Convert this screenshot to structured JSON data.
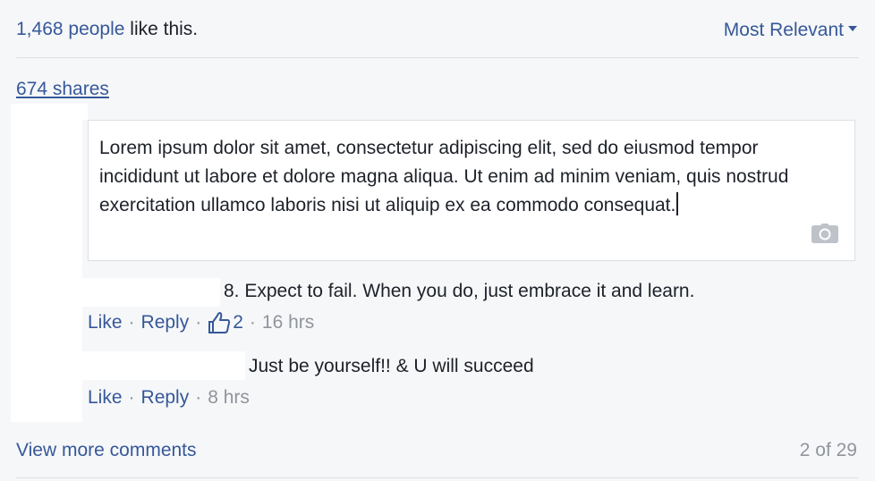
{
  "likes": {
    "count_link": "1,468 people",
    "suffix": " like this."
  },
  "sort": {
    "label": "Most Relevant"
  },
  "shares": {
    "label": "674 shares"
  },
  "composer": {
    "text": "Lorem ipsum dolor sit amet, consectetur adipiscing elit, sed do eiusmod tempor incididunt ut labore et dolore magna aliqua. Ut enim ad minim veniam, quis nostrud exercitation ullamco laboris nisi ut aliquip ex ea commodo consequat.",
    "camera_icon": "camera-icon"
  },
  "comments": [
    {
      "text": "8. Expect to fail. When you do, just embrace it and learn.",
      "like_label": "Like",
      "reply_label": "Reply",
      "reaction_count": "2",
      "time": "16 hrs",
      "reaction_icon": "thumbs-up-icon"
    },
    {
      "text": "Just be yourself!! & U will succeed",
      "like_label": "Like",
      "reply_label": "Reply",
      "time": "8 hrs"
    }
  ],
  "separator": "·",
  "footer": {
    "view_more": "View more comments",
    "count": "2 of 29"
  },
  "colors": {
    "link": "#365899",
    "muted": "#90949c",
    "background": "#f6f7f9"
  }
}
